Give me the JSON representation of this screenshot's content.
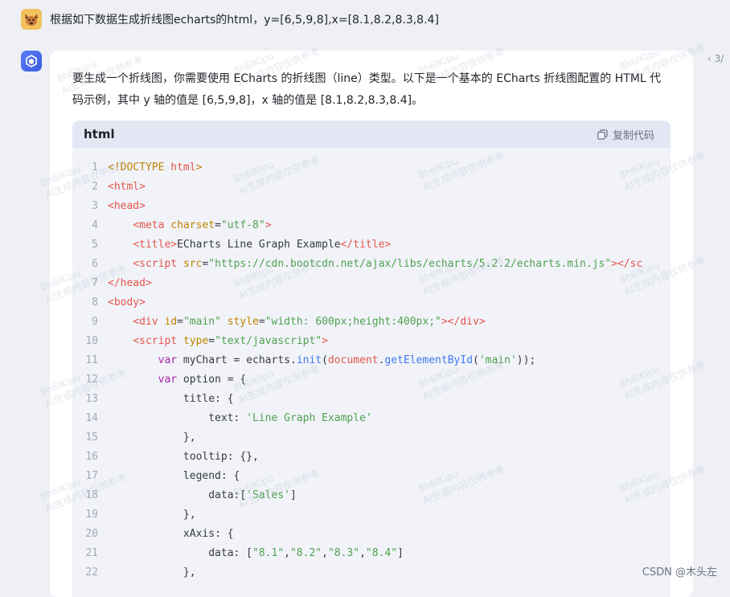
{
  "user_message": {
    "text": "根据如下数据生成折线图echarts的html，y=[6,5,9,8],x=[8.1,8.2,8.3,8.4]"
  },
  "pager": {
    "text": "‹ 3/"
  },
  "ai_reply": {
    "intro": "要生成一个折线图，你需要使用 ECharts 的折线图（line）类型。以下是一个基本的 ECharts 折线图配置的 HTML 代码示例，其中 y 轴的值是 [6,5,9,8]，x 轴的值是 [8.1,8.2,8.3,8.4]。",
    "code_block": {
      "language": "html",
      "copy_label": "复制代码",
      "lines": [
        {
          "n": "1",
          "tokens": [
            {
              "t": "<!DOCTYPE ",
              "c": "t-attr"
            },
            {
              "t": "html",
              "c": "t-tag"
            },
            {
              "t": ">",
              "c": "t-attr"
            }
          ]
        },
        {
          "n": "2",
          "tokens": [
            {
              "t": "<html>",
              "c": "t-tag"
            }
          ]
        },
        {
          "n": "3",
          "tokens": [
            {
              "t": "<head>",
              "c": "t-tag"
            }
          ]
        },
        {
          "n": "4",
          "tokens": [
            {
              "t": "    ",
              "c": "t-plain"
            },
            {
              "t": "<meta ",
              "c": "t-tag"
            },
            {
              "t": "charset",
              "c": "t-attr"
            },
            {
              "t": "=",
              "c": "t-plain"
            },
            {
              "t": "\"utf-8\"",
              "c": "t-str"
            },
            {
              "t": ">",
              "c": "t-tag"
            }
          ]
        },
        {
          "n": "5",
          "tokens": [
            {
              "t": "    ",
              "c": "t-plain"
            },
            {
              "t": "<title>",
              "c": "t-tag"
            },
            {
              "t": "ECharts Line Graph Example",
              "c": "t-plain"
            },
            {
              "t": "</title>",
              "c": "t-tag"
            }
          ]
        },
        {
          "n": "6",
          "tokens": [
            {
              "t": "    ",
              "c": "t-plain"
            },
            {
              "t": "<script ",
              "c": "t-tag"
            },
            {
              "t": "src",
              "c": "t-attr"
            },
            {
              "t": "=",
              "c": "t-plain"
            },
            {
              "t": "\"https://cdn.bootcdn.net/ajax/libs/echarts/5.2.2/echarts.min.js\"",
              "c": "t-str"
            },
            {
              "t": "></sc",
              "c": "t-tag"
            }
          ]
        },
        {
          "n": "7",
          "tokens": [
            {
              "t": "</head>",
              "c": "t-tag"
            }
          ]
        },
        {
          "n": "8",
          "tokens": [
            {
              "t": "<body>",
              "c": "t-tag"
            }
          ]
        },
        {
          "n": "9",
          "tokens": [
            {
              "t": "    ",
              "c": "t-plain"
            },
            {
              "t": "<div ",
              "c": "t-tag"
            },
            {
              "t": "id",
              "c": "t-attr"
            },
            {
              "t": "=",
              "c": "t-plain"
            },
            {
              "t": "\"main\"",
              "c": "t-str"
            },
            {
              "t": " style",
              "c": "t-attr"
            },
            {
              "t": "=",
              "c": "t-plain"
            },
            {
              "t": "\"width: 600px;height:400px;\"",
              "c": "t-str"
            },
            {
              "t": "></div>",
              "c": "t-tag"
            }
          ]
        },
        {
          "n": "10",
          "tokens": [
            {
              "t": "    ",
              "c": "t-plain"
            },
            {
              "t": "<script ",
              "c": "t-tag"
            },
            {
              "t": "type",
              "c": "t-attr"
            },
            {
              "t": "=",
              "c": "t-plain"
            },
            {
              "t": "\"text/javascript\"",
              "c": "t-str"
            },
            {
              "t": ">",
              "c": "t-tag"
            }
          ]
        },
        {
          "n": "11",
          "tokens": [
            {
              "t": "        ",
              "c": "t-plain"
            },
            {
              "t": "var",
              "c": "t-kw"
            },
            {
              "t": " myChart = echarts.",
              "c": "t-plain"
            },
            {
              "t": "init",
              "c": "t-fn"
            },
            {
              "t": "(",
              "c": "t-plain"
            },
            {
              "t": "document",
              "c": "t-tag"
            },
            {
              "t": ".",
              "c": "t-plain"
            },
            {
              "t": "getElementById",
              "c": "t-fn"
            },
            {
              "t": "(",
              "c": "t-plain"
            },
            {
              "t": "'main'",
              "c": "t-str"
            },
            {
              "t": "));",
              "c": "t-plain"
            }
          ]
        },
        {
          "n": "12",
          "tokens": [
            {
              "t": "        ",
              "c": "t-plain"
            },
            {
              "t": "var",
              "c": "t-kw"
            },
            {
              "t": " option = {",
              "c": "t-plain"
            }
          ]
        },
        {
          "n": "13",
          "tokens": [
            {
              "t": "            title: {",
              "c": "t-plain"
            }
          ]
        },
        {
          "n": "14",
          "tokens": [
            {
              "t": "                text: ",
              "c": "t-plain"
            },
            {
              "t": "'Line Graph Example'",
              "c": "t-str"
            }
          ]
        },
        {
          "n": "15",
          "tokens": [
            {
              "t": "            },",
              "c": "t-plain"
            }
          ]
        },
        {
          "n": "16",
          "tokens": [
            {
              "t": "            tooltip: {},",
              "c": "t-plain"
            }
          ]
        },
        {
          "n": "17",
          "tokens": [
            {
              "t": "            legend: {",
              "c": "t-plain"
            }
          ]
        },
        {
          "n": "18",
          "tokens": [
            {
              "t": "                data:[",
              "c": "t-plain"
            },
            {
              "t": "'Sales'",
              "c": "t-str"
            },
            {
              "t": "]",
              "c": "t-plain"
            }
          ]
        },
        {
          "n": "19",
          "tokens": [
            {
              "t": "            },",
              "c": "t-plain"
            }
          ]
        },
        {
          "n": "20",
          "tokens": [
            {
              "t": "            xAxis: {",
              "c": "t-plain"
            }
          ]
        },
        {
          "n": "21",
          "tokens": [
            {
              "t": "                data: [",
              "c": "t-plain"
            },
            {
              "t": "\"8.1\"",
              "c": "t-str"
            },
            {
              "t": ",",
              "c": "t-plain"
            },
            {
              "t": "\"8.2\"",
              "c": "t-str"
            },
            {
              "t": ",",
              "c": "t-plain"
            },
            {
              "t": "\"8.3\"",
              "c": "t-str"
            },
            {
              "t": ",",
              "c": "t-plain"
            },
            {
              "t": "\"8.4\"",
              "c": "t-str"
            },
            {
              "t": "]",
              "c": "t-plain"
            }
          ]
        },
        {
          "n": "22",
          "tokens": [
            {
              "t": "            },",
              "c": "t-plain"
            }
          ]
        }
      ]
    }
  },
  "watermark": {
    "line1": "8h6lKipu",
    "line2": "AI生成内容仅供参考"
  },
  "footer": {
    "credit": "CSDN @木头左"
  }
}
